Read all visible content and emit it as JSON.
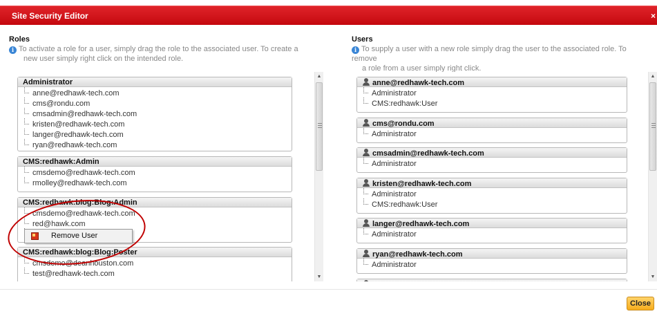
{
  "dialog": {
    "title": "Site Security Editor",
    "close_glyph": "×"
  },
  "roles_section": {
    "title": "Roles",
    "help": "To activate a role for a user, simply drag the role to the associated user. To create a new user simply right click on the intended role.",
    "help_line1": "To activate a role for a user, simply drag the role to the associated user. To create a",
    "help_line2": "new user simply right click on the intended role.",
    "cards": [
      {
        "name": "Administrator",
        "items": [
          "anne@redhawk-tech.com",
          "cms@rondu.com",
          "cmsadmin@redhawk-tech.com",
          "kristen@redhawk-tech.com",
          "langer@redhawk-tech.com",
          "ryan@redhawk-tech.com"
        ]
      },
      {
        "name": "CMS:redhawk:Admin",
        "items": [
          "cmsdemo@redhawk-tech.com",
          "rmolley@redhawk-tech.com"
        ]
      },
      {
        "name": "CMS:redhawk:blog:Blog:Admin",
        "items": [
          "cmsdemo@redhawk-tech.com",
          "red@hawk.com",
          ""
        ]
      },
      {
        "name": "CMS:redhawk:blog:Blog:Poster",
        "items": [
          "cmsdemo@deanhouston.com",
          "test@redhawk-tech.com"
        ]
      }
    ]
  },
  "context_menu": {
    "item_label": "Remove User",
    "icon": "remove-user-icon"
  },
  "users_section": {
    "title": "Users",
    "help": "To supply a user with a new role simply drag the user to the associated role. To remove a role from a user simply right click.",
    "help_line1": "To supply a user with a new role simply drag the user to the associated role. To remove",
    "help_line2": "a role from a user simply right click.",
    "cards": [
      {
        "name": "anne@redhawk-tech.com",
        "items": [
          "Administrator",
          "CMS:redhawk:User"
        ]
      },
      {
        "name": "cms@rondu.com",
        "items": [
          "Administrator"
        ]
      },
      {
        "name": "cmsadmin@redhawk-tech.com",
        "items": [
          "Administrator"
        ]
      },
      {
        "name": "kristen@redhawk-tech.com",
        "items": [
          "Administrator",
          "CMS:redhawk:User"
        ]
      },
      {
        "name": "langer@redhawk-tech.com",
        "items": [
          "Administrator"
        ]
      },
      {
        "name": "ryan@redhawk-tech.com",
        "items": [
          "Administrator"
        ]
      }
    ]
  },
  "footer": {
    "close_label": "Close"
  },
  "colors": {
    "title_bar": "#d0121a",
    "close_button": "#f6ac1c",
    "annotation": "#c00000"
  }
}
